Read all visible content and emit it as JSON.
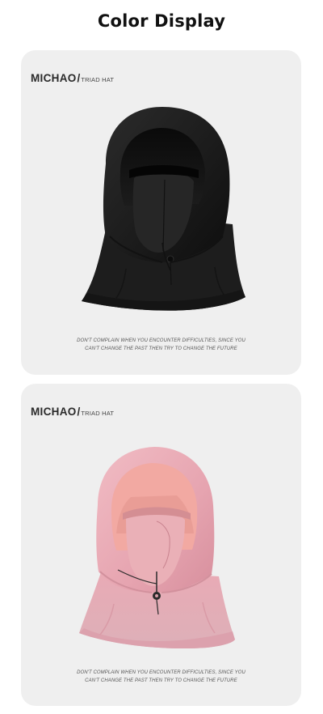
{
  "page": {
    "title": "Color Display"
  },
  "cards": [
    {
      "brand": "MICHAO",
      "slash": "/",
      "subtitle": "TRIAD HAT",
      "color": "#1a1a1a",
      "caption_line1": "DON'T COMPLAIN WHEN YOU ENCOUNTER DIFFICULTIES, SINCE YOU",
      "caption_line2": "CAN'T CHANGE THE PAST THEN TRY TO CHANGE THE FUTURE"
    },
    {
      "brand": "MICHAO",
      "slash": "/",
      "subtitle": "TRIAD HAT",
      "color": "#e9aab4",
      "caption_line1": "DON'T COMPLAIN WHEN YOU ENCOUNTER DIFFICULTIES, SINCE YOU",
      "caption_line2": "CAN'T CHANGE THE PAST THEN TRY TO CHANGE THE FUTURE"
    }
  ]
}
